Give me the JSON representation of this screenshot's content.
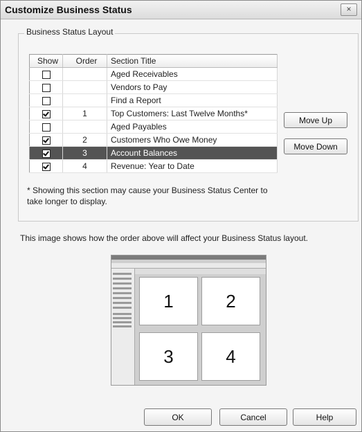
{
  "window": {
    "title": "Customize Business Status",
    "close_symbol": "×"
  },
  "layout_group": {
    "label": "Business Status Layout",
    "columns": {
      "show": "Show",
      "order": "Order",
      "title": "Section Title"
    },
    "rows": [
      {
        "show": false,
        "order": "",
        "title": "Aged Receivables",
        "selected": false
      },
      {
        "show": false,
        "order": "",
        "title": "Vendors to Pay",
        "selected": false
      },
      {
        "show": false,
        "order": "",
        "title": "Find a Report",
        "selected": false
      },
      {
        "show": true,
        "order": "1",
        "title": "Top Customers: Last Twelve Months*",
        "selected": false
      },
      {
        "show": false,
        "order": "",
        "title": "Aged Payables",
        "selected": false
      },
      {
        "show": true,
        "order": "2",
        "title": "Customers Who Owe Money",
        "selected": false
      },
      {
        "show": true,
        "order": "3",
        "title": "Account Balances",
        "selected": true
      },
      {
        "show": true,
        "order": "4",
        "title": "Revenue: Year to Date",
        "selected": false
      }
    ],
    "move_up": "Move Up",
    "move_down": "Move Down",
    "note": "* Showing this section may cause your Business Status Center to take longer to display."
  },
  "preview": {
    "caption": "This image shows how the order above will affect your Business Status layout.",
    "panes": [
      "1",
      "2",
      "3",
      "4"
    ]
  },
  "footer": {
    "ok": "OK",
    "cancel": "Cancel",
    "help": "Help"
  }
}
